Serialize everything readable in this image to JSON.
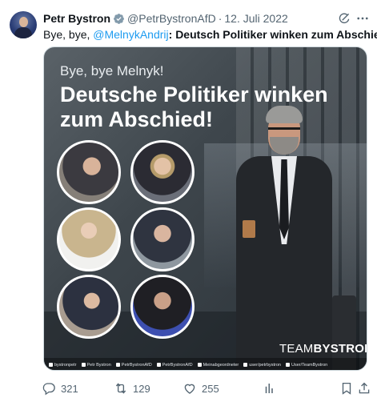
{
  "author": {
    "name": "Petr Bystron",
    "handle": "@PetrBystronAfD",
    "separator": "·",
    "date": "12. Juli 2022"
  },
  "tweet": {
    "text_start": "Bye, bye, ",
    "mention": "@MelnykAndrij",
    "text_separator": ": ",
    "text_bold": "Deutsch Politiker winken zum Abschied",
    "text_end": "!"
  },
  "media": {
    "subtitle": "Bye, bye Melnyk!",
    "headline": "Deutsche Politiker winken zum Abschied!",
    "brand_thin": "TEAM",
    "brand_bold": "BYSTRON",
    "socials": [
      "bystronpetr",
      "Petr Bystron",
      "PetrBystronAfD",
      "PetrBystronAfD",
      "Meinabgeordneter",
      "user/petrbystron",
      "User/TeamBystron"
    ]
  },
  "actions": {
    "replies": "321",
    "retweets": "129",
    "likes": "255"
  },
  "icons": {
    "verified": "verified-badge-icon",
    "grok": "grok-icon",
    "more": "more-icon",
    "reply": "reply-icon",
    "retweet": "retweet-icon",
    "like": "heart-icon",
    "views": "views-icon",
    "bookmark": "bookmark-icon",
    "share": "share-icon"
  },
  "colors": {
    "accent": "#1d9bf0",
    "text": "#0f1419",
    "muted": "#536471"
  }
}
